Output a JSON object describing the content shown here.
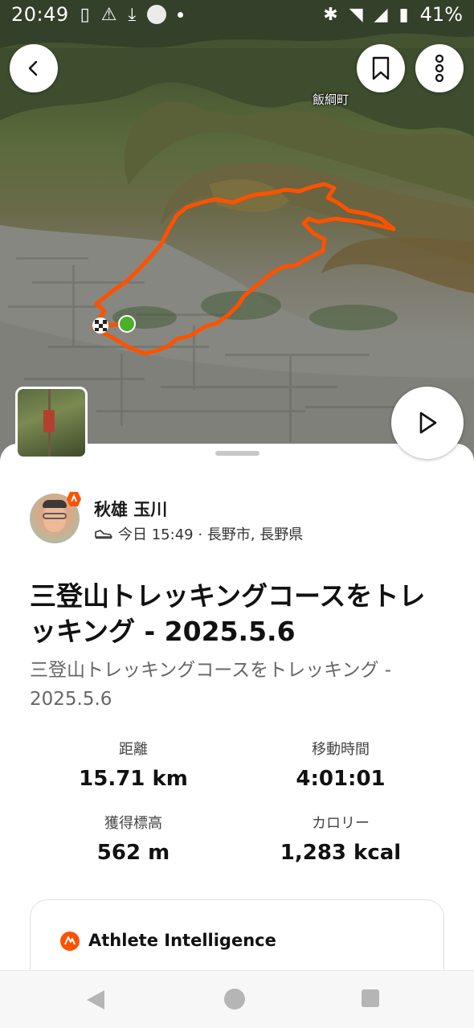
{
  "status_bar": {
    "time": "20:49",
    "battery": "41%"
  },
  "map": {
    "place_label": "飯綱町"
  },
  "activity": {
    "athlete_name": "秋雄 玉川",
    "meta": "今日 15:49 · 長野市, 長野県",
    "title": "三登山トレッキングコースをトレッキング - 2025.5.6",
    "subtitle": "三登山トレッキングコースをトレッキング - 2025.5.6",
    "stats": [
      {
        "label": "距離",
        "value": "15.71 km"
      },
      {
        "label": "移動時間",
        "value": "4:01:01"
      },
      {
        "label": "獲得標高",
        "value": "562 m"
      },
      {
        "label": "カロリー",
        "value": "1,283 kcal"
      }
    ]
  },
  "athlete_intelligence": {
    "title": "Athlete Intelligence"
  },
  "colors": {
    "route": "#fc5200",
    "start_marker": "#4caf2a",
    "brand": "#fc5200"
  },
  "icons": {
    "back": "chevron-left-icon",
    "bookmark": "bookmark-icon",
    "more": "more-vertical-icon",
    "play": "play-icon",
    "shoe": "shoe-icon",
    "ai": "athlete-intelligence-icon"
  }
}
